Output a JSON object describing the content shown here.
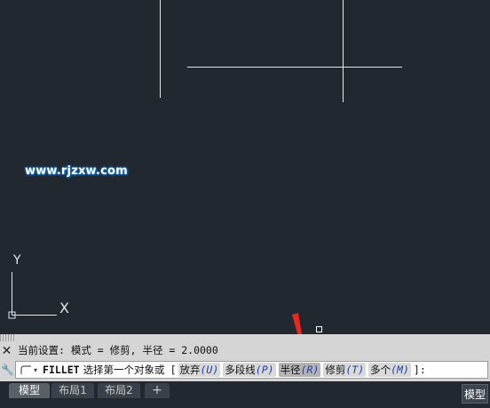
{
  "canvas": {
    "background": "#212830",
    "watermark": "www.rjzxw.com",
    "ucs": {
      "x_label": "X",
      "y_label": "Y"
    }
  },
  "command": {
    "history": "当前设置: 模式 = 修剪, 半径 = 2.0000",
    "command_name": "FILLET",
    "prompt": "选择第一个对象或",
    "bracket_open": "[",
    "options": [
      {
        "label": "放弃",
        "key": "(U)"
      },
      {
        "label": "多段线",
        "key": "(P)"
      },
      {
        "label": "半径",
        "key": "(R)"
      },
      {
        "label": "修剪",
        "key": "(T)"
      },
      {
        "label": "多个",
        "key": "(M)"
      }
    ],
    "tail": "]:",
    "close_icon": "close-icon",
    "customize_icon": "wrench-icon"
  },
  "tabs": [
    {
      "label": "模型",
      "active": true
    },
    {
      "label": "布局1",
      "active": false
    },
    {
      "label": "布局2",
      "active": false
    },
    {
      "label": "+",
      "active": false
    }
  ],
  "status": {
    "space_label": "模型"
  },
  "colors": {
    "pointer_arrow": "#e8281e",
    "option_key": "#1f3fb0"
  }
}
